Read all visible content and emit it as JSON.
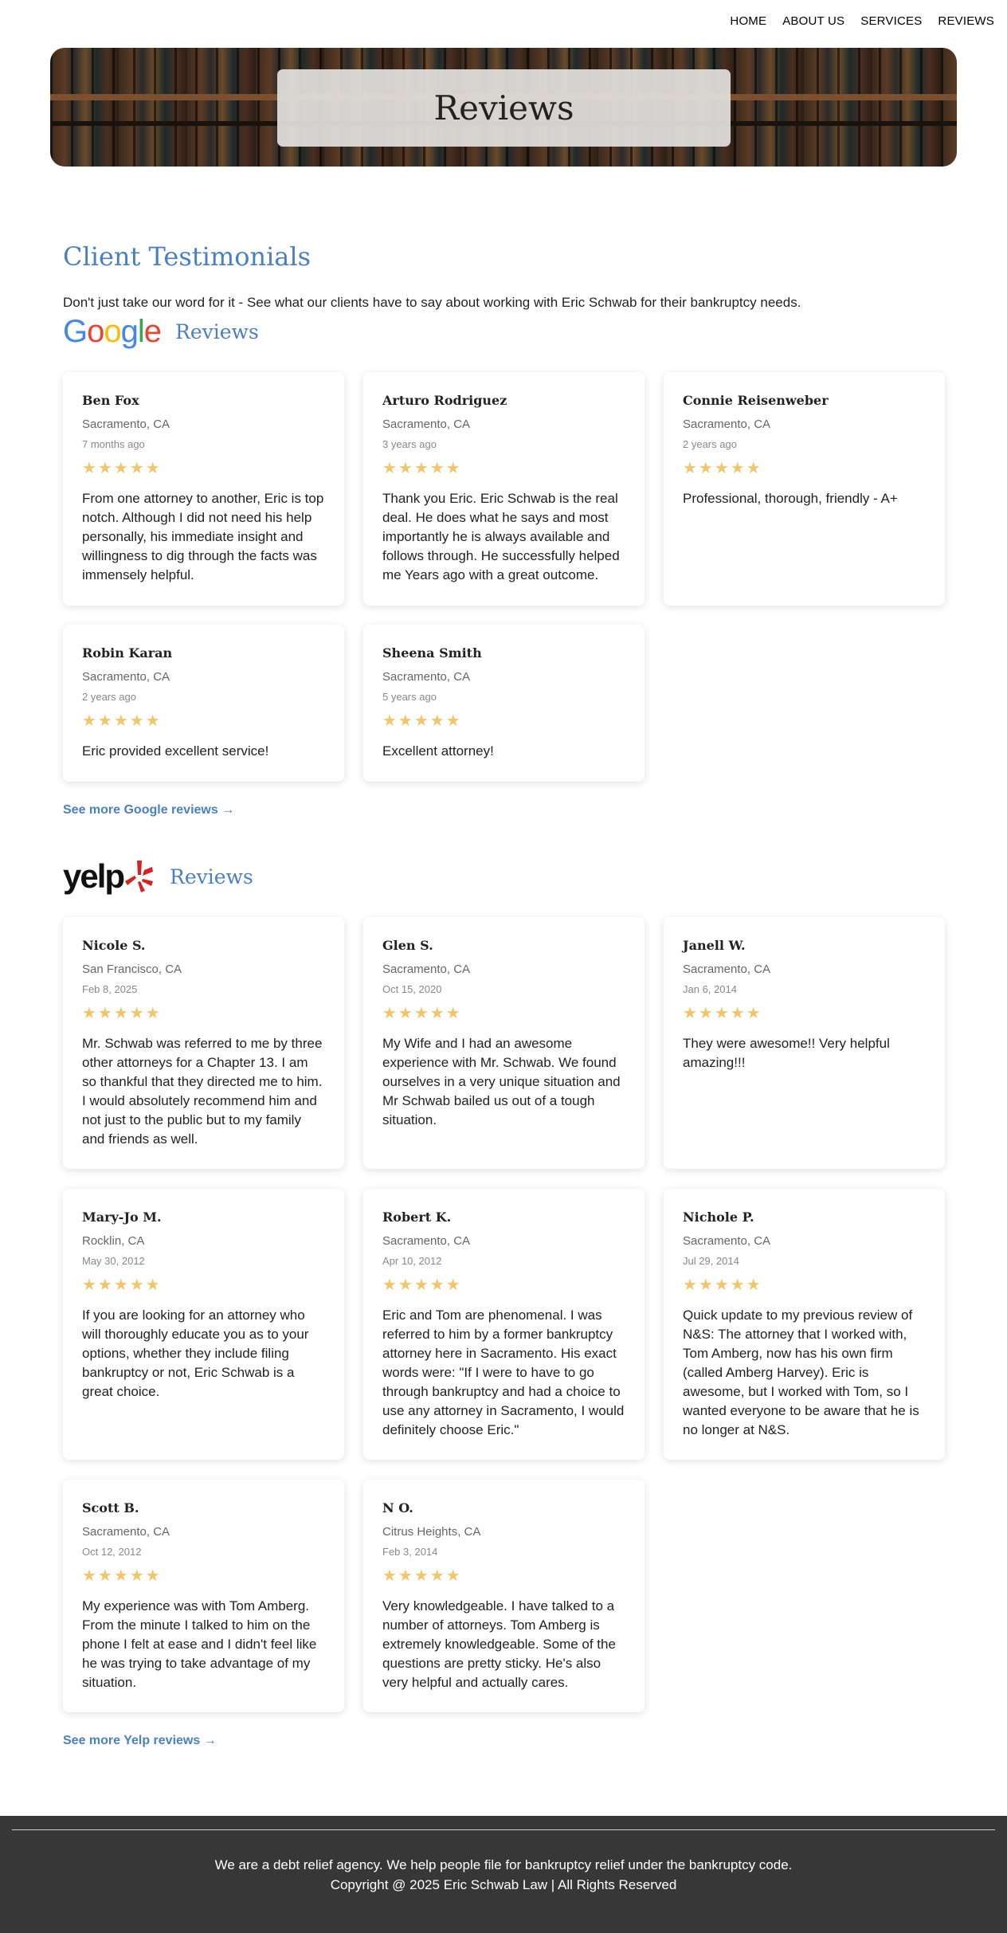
{
  "nav": {
    "items": [
      {
        "label": "HOME"
      },
      {
        "label": "ABOUT US"
      },
      {
        "label": "SERVICES"
      },
      {
        "label": "REVIEWS"
      }
    ]
  },
  "hero": {
    "title": "Reviews"
  },
  "main": {
    "title": "Client Testimonials",
    "intro": "Don't just take our word for it - See what our clients have to say about working with Eric Schwab for their bankruptcy needs."
  },
  "google": {
    "logo_text": "Google",
    "logo_colors": [
      "#4285F4",
      "#EA4335",
      "#FBBC05",
      "#4285F4",
      "#34A853",
      "#EA4335"
    ],
    "section_label": "Reviews",
    "more_link": "See more Google reviews →",
    "reviews": [
      {
        "name": "Ben Fox",
        "location": "Sacramento, CA",
        "date": "7 months ago",
        "stars": "★★★★★",
        "text": "From one attorney to another, Eric is top notch. Although I did not need his help personally, his immediate insight and willingness to dig through the facts was immensely helpful."
      },
      {
        "name": "Arturo Rodriguez",
        "location": "Sacramento, CA",
        "date": "3 years ago",
        "stars": "★★★★★",
        "text": "Thank you Eric. Eric Schwab is the real deal. He does what he says and most importantly he is always available and follows through. He successfully helped me Years ago with a great outcome."
      },
      {
        "name": "Connie Reisenweber",
        "location": "Sacramento, CA",
        "date": "2 years ago",
        "stars": "★★★★★",
        "text": "Professional, thorough, friendly - A+"
      },
      {
        "name": "Robin Karan",
        "location": "Sacramento, CA",
        "date": "2 years ago",
        "stars": "★★★★★",
        "text": "Eric provided excellent service!"
      },
      {
        "name": "Sheena Smith",
        "location": "Sacramento, CA",
        "date": "5 years ago",
        "stars": "★★★★★",
        "text": "Excellent attorney!"
      }
    ]
  },
  "yelp": {
    "logo_text": "yelp",
    "logo_color": "#d32323",
    "section_label": "Reviews",
    "more_link": "See more Yelp reviews →",
    "reviews": [
      {
        "name": "Nicole S.",
        "location": "San Francisco, CA",
        "date": "Feb 8, 2025",
        "stars": "★★★★★",
        "text": "Mr. Schwab was referred to me by three other attorneys for a Chapter 13. I am so thankful that they directed me to him. I would absolutely recommend him and not just to the public but to my family and friends as well."
      },
      {
        "name": "Glen S.",
        "location": "Sacramento, CA",
        "date": "Oct 15, 2020",
        "stars": "★★★★★",
        "text": "My Wife and I had an awesome experience with Mr. Schwab. We found ourselves in a very unique situation and Mr Schwab bailed us out of a tough situation."
      },
      {
        "name": "Janell W.",
        "location": "Sacramento, CA",
        "date": "Jan 6, 2014",
        "stars": "★★★★★",
        "text": "They were awesome!! Very helpful amazing!!!"
      },
      {
        "name": "Mary-Jo M.",
        "location": "Rocklin, CA",
        "date": "May 30, 2012",
        "stars": "★★★★★",
        "text": "If you are looking for an attorney who will thoroughly educate you as to your options, whether they include filing bankruptcy or not, Eric Schwab is a great choice."
      },
      {
        "name": "Robert K.",
        "location": "Sacramento, CA",
        "date": "Apr 10, 2012",
        "stars": "★★★★★",
        "text": "Eric and Tom are phenomenal. I was referred to him by a former bankruptcy attorney here in Sacramento. His exact words were: \"If I were to have to go through bankruptcy and had a choice to use any attorney in Sacramento, I would definitely choose Eric.\""
      },
      {
        "name": "Nichole P.",
        "location": "Sacramento, CA",
        "date": "Jul 29, 2014",
        "stars": "★★★★★",
        "text": "Quick update to my previous review of N&S: The attorney that I worked with, Tom Amberg, now has his own firm (called Amberg Harvey). Eric is awesome, but I worked with Tom, so I wanted everyone to be aware that he is no longer at N&S."
      },
      {
        "name": "Scott B.",
        "location": "Sacramento, CA",
        "date": "Oct 12, 2012",
        "stars": "★★★★★",
        "text": "My experience was with Tom Amberg. From the minute I talked to him on the phone I felt at ease and I didn't feel like he was trying to take advantage of my situation."
      },
      {
        "name": "N O.",
        "location": "Citrus Heights, CA",
        "date": "Feb 3, 2014",
        "stars": "★★★★★",
        "text": "Very knowledgeable. I have talked to a number of attorneys. Tom Amberg is extremely knowledgeable. Some of the questions are pretty sticky. He's also very helpful and actually cares."
      }
    ]
  },
  "footer": {
    "line1": "We are a debt relief agency. We help people file for bankruptcy relief under the bankruptcy code.",
    "line2": "Copyright @ 2025 Eric Schwab Law | All Rights Reserved"
  },
  "colors": {
    "accent": "#4a7fc6",
    "star": "#f2c56b",
    "footer_bg": "#373737"
  }
}
